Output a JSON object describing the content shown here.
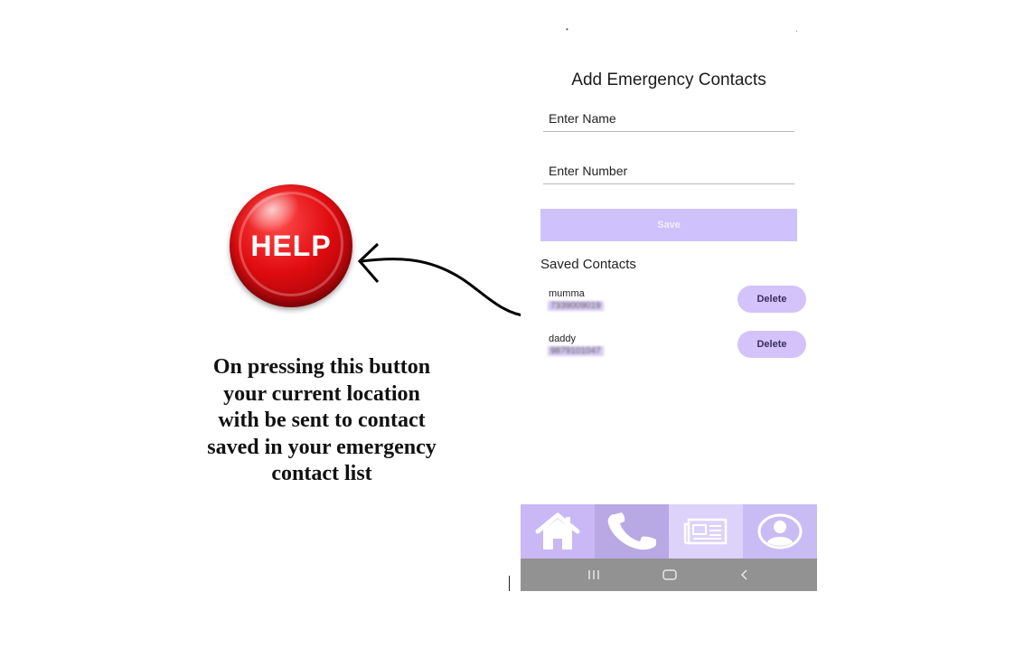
{
  "help_button": {
    "label": "HELP"
  },
  "caption": {
    "lines": [
      "On pressing this button",
      "your current location",
      "with be sent to contact",
      "saved in your emergency",
      "contact list"
    ]
  },
  "screen": {
    "title": "Add Emergency Contacts",
    "name_field": {
      "placeholder": "Enter Name",
      "value": ""
    },
    "number_field": {
      "placeholder": "Enter Number",
      "value": ""
    },
    "save_label": "Save",
    "saved_heading": "Saved Contacts",
    "contacts": [
      {
        "name": "mumma",
        "number": "7339009019",
        "delete_label": "Delete"
      },
      {
        "name": "daddy",
        "number": "9879101047",
        "delete_label": "Delete"
      }
    ]
  },
  "tabs": [
    {
      "icon": "home-icon",
      "color": "#c9b8f5"
    },
    {
      "icon": "phone-icon",
      "color": "#b8a8e4"
    },
    {
      "icon": "newspaper-icon",
      "color": "#ddd2fa"
    },
    {
      "icon": "profile-icon",
      "color": "#c9bcf4"
    }
  ],
  "colors": {
    "accent": "#cfc1fb",
    "help_red": "#e00c10",
    "navbar": "#929292"
  }
}
